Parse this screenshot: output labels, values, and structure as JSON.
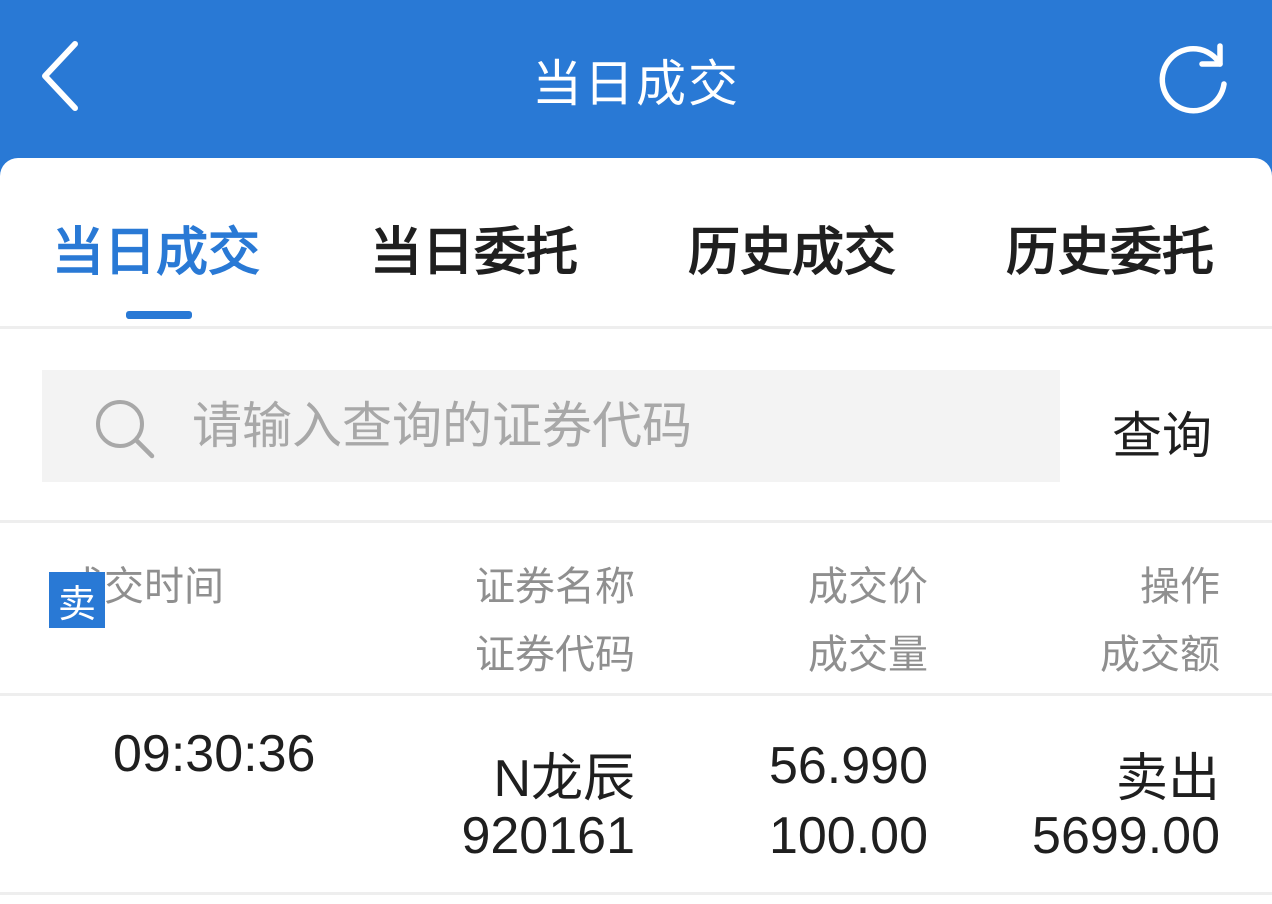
{
  "header": {
    "title": "当日成交"
  },
  "tabs": [
    {
      "label": "当日成交",
      "active": true
    },
    {
      "label": "当日委托",
      "active": false
    },
    {
      "label": "历史成交",
      "active": false
    },
    {
      "label": "历史委托",
      "active": false
    }
  ],
  "search": {
    "placeholder": "请输入查询的证券代码",
    "value": "",
    "button_label": "查询"
  },
  "table": {
    "headers": {
      "time": "成交时间",
      "name": "证券名称",
      "code": "证券代码",
      "price": "成交价",
      "volume": "成交量",
      "action": "操作",
      "amount": "成交额"
    },
    "rows": [
      {
        "badge": "卖",
        "time": "09:30:36",
        "name": "N龙辰",
        "code": "920161",
        "price": "56.990",
        "volume": "100.00",
        "action": "卖出",
        "amount": "5699.00"
      }
    ]
  },
  "colors": {
    "accent": "#2979d5",
    "header_text": "#ffffff",
    "muted": "#8f8f8f"
  },
  "icons": {
    "back": "chevron-left-icon",
    "refresh": "refresh-icon",
    "search": "search-icon"
  }
}
